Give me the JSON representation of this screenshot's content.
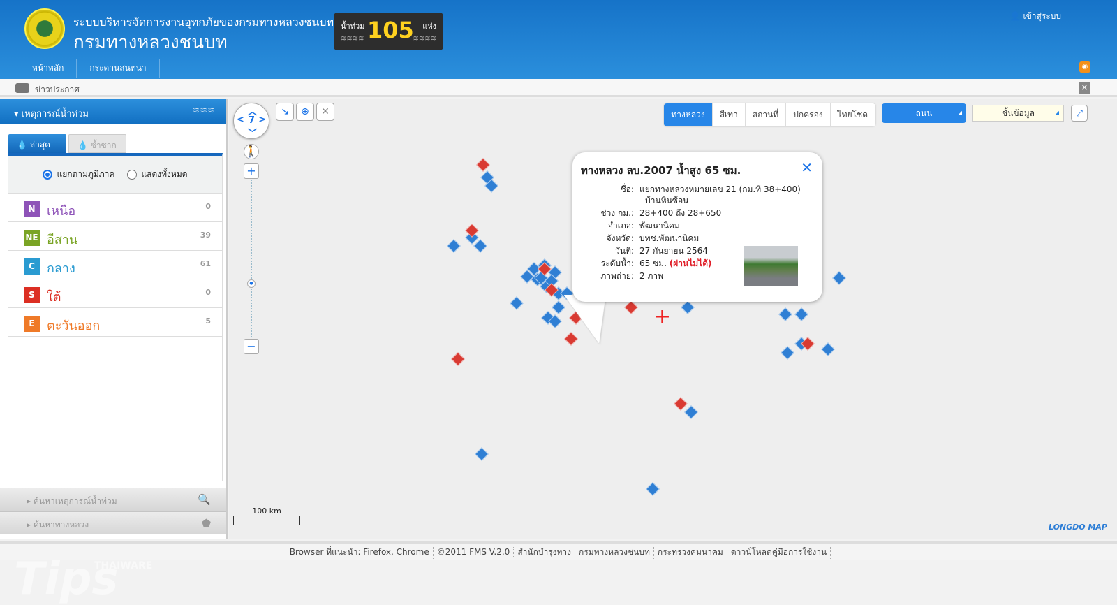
{
  "header": {
    "subtitle": "ระบบบริหารจัดการงานอุทกภัยของกรมทางหลวงชนบท",
    "title": "กรมทางหลวงชนบท",
    "badge": {
      "label_left": "น้ำท่วม",
      "count": "105",
      "label_right": "แห่ง"
    },
    "login": "เข้าสู่ระบบ"
  },
  "nav": [
    "หน้าหลัก",
    "กระดานสนทนา"
  ],
  "newsbar": {
    "label": "ข่าวประกาศ",
    "close": "×"
  },
  "sidebar": {
    "title": "เหตุการณ์น้ำท่วม",
    "tabs": [
      "ล่าสุด",
      "ซ้ำซาก"
    ],
    "radios": [
      "แยกตามภูมิภาค",
      "แสดงทั้งหมด"
    ],
    "regions": [
      {
        "badge": "N",
        "name": "เหนือ",
        "count": "0",
        "color": "#8e53b8"
      },
      {
        "badge": "NE",
        "name": "อีสาน",
        "count": "39",
        "color": "#7aa425"
      },
      {
        "badge": "C",
        "name": "กลาง",
        "count": "61",
        "color": "#2a9bd1"
      },
      {
        "badge": "S",
        "name": "ใต้",
        "count": "0",
        "color": "#dc2f23"
      },
      {
        "badge": "E",
        "name": "ตะวันออก",
        "count": "5",
        "color": "#ef7a28"
      }
    ],
    "search_flood": "ค้นหาเหตุการณ์น้ำท่วม",
    "search_road": "ค้นหาทางหลวง"
  },
  "watermark": {
    "brand": "THAIWARE",
    "text": "Tips"
  },
  "map": {
    "zoom_level": "7",
    "layers": [
      "ทางหลวง",
      "สีเทา",
      "สถานที่",
      "ปกครอง",
      "ไทยโชด"
    ],
    "active_layer": "ทางหลวง",
    "road_select": "ถนน",
    "data_select": "ชั้นข้อมูล",
    "scale": "100 km",
    "attribution": "LONGDO MAP",
    "marker_colors": {
      "blue": "#2f7fd4",
      "red": "#d93a32"
    },
    "popup": {
      "title": "ทางหลวง ลบ.2007 น้ำสูง 65 ซม.",
      "rows": [
        {
          "k": "ชื่อ:",
          "v": "แยกทางหลวงหมายเลข 21 (กม.ที่ 38+400)",
          "v2": "- บ้านหินซ้อน"
        },
        {
          "k": "ช่วง กม.:",
          "v": "28+400 ถึง 28+650"
        },
        {
          "k": "อำเภอ:",
          "v": "พัฒนานิคม"
        },
        {
          "k": "จังหวัด:",
          "v": "บทช.พัฒนานิคม"
        },
        {
          "k": "วันที่:",
          "v": "27 กันยายน 2564"
        },
        {
          "k": "ระดับน้ำ:",
          "v": "65 ซม.",
          "status": "(ผ่านไม่ได้)"
        },
        {
          "k": "ภาพถ่าย:",
          "v": "2 ภาพ"
        }
      ]
    }
  },
  "footer": [
    "Browser ที่แนะนำ: Firefox, Chrome",
    "©2011 FMS V.2.0",
    "สำนักบำรุงทาง",
    "กรมทางหลวงชนบท",
    "กระทรวงคมนาคม",
    "ดาวน์โหลดคู่มือการใช้งาน"
  ]
}
